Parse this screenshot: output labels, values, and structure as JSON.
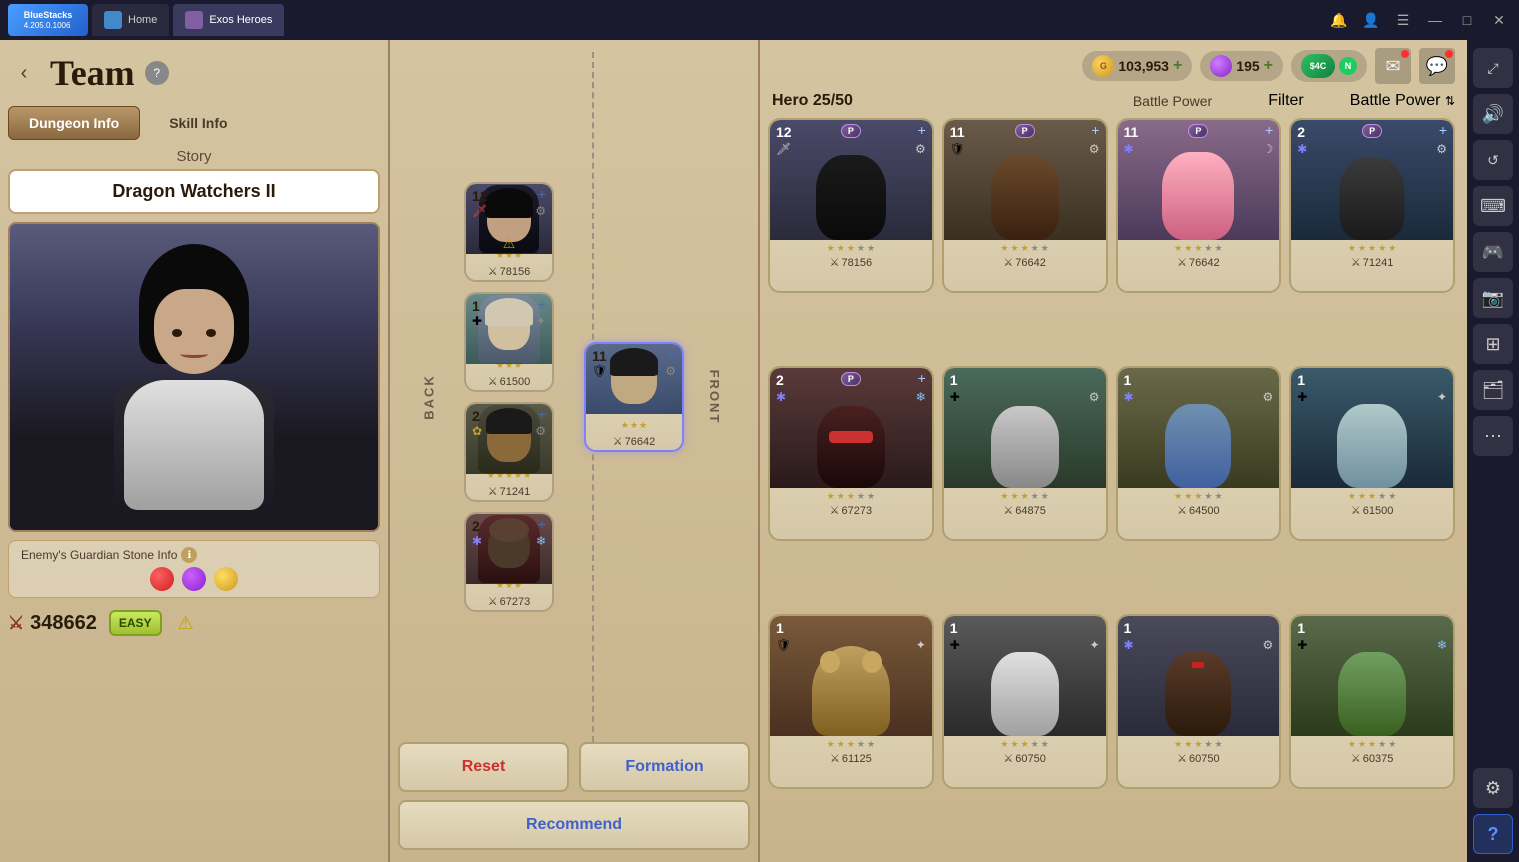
{
  "app": {
    "name": "BlueStacks",
    "version": "4.205.0.1006"
  },
  "taskbar": {
    "tabs": [
      {
        "id": "home",
        "label": "Home",
        "active": false
      },
      {
        "id": "exos",
        "label": "Exos Heroes",
        "active": true
      }
    ],
    "controls": [
      "—",
      "□",
      "✕"
    ]
  },
  "header": {
    "back_label": "‹",
    "title": "Team",
    "help": "?"
  },
  "currency": {
    "gold_amount": "103,953",
    "gem_amount": "195",
    "special_label": "$4C",
    "special_n": "N"
  },
  "tabs": [
    {
      "id": "dungeon",
      "label": "Dungeon Info",
      "active": true
    },
    {
      "id": "skill",
      "label": "Skill Info",
      "active": false
    }
  ],
  "story": {
    "label": "Story",
    "dungeon_name": "Dragon Watchers II"
  },
  "guardian_info": {
    "title": "Enemy's Guardian Stone Info",
    "info_icon": "ℹ"
  },
  "stats": {
    "battle_power": "348662",
    "difficulty": "EASY"
  },
  "formation": {
    "back_label": "BACK",
    "front_label": "FRONT",
    "heroes": [
      {
        "id": 1,
        "level": "12",
        "power": "78156",
        "stars": 3,
        "element": "🗡",
        "gear": "⚙",
        "warning": true,
        "bg": "avatar-1"
      },
      {
        "id": 2,
        "level": "1",
        "power": "61500",
        "stars": 3,
        "element": "✚",
        "gear": "✦",
        "warning": false,
        "bg": "avatar-2"
      },
      {
        "id": 3,
        "level": "2",
        "power": "71241",
        "stars": 5,
        "element": "✿",
        "gear": "⚙",
        "warning": false,
        "bg": "avatar-3"
      },
      {
        "id": 4,
        "level": "2",
        "power": "67273",
        "stars": 3,
        "element": "✱",
        "gear": "❄",
        "warning": false,
        "bg": "avatar-4"
      }
    ],
    "front_hero": {
      "level": "11",
      "power": "76642",
      "stars": 3,
      "bg": "avatar-5"
    },
    "reset_label": "Reset",
    "formation_label": "Formation",
    "recommend_label": "Recommend"
  },
  "hero_list": {
    "header": "Hero",
    "count": "25/50",
    "battle_power_label": "Battle Power",
    "filter_label": "Filter",
    "battle_power_label2": "Battle Power",
    "sort_icon": "⇅",
    "heroes": [
      {
        "id": 1,
        "level": "12",
        "power": "78156",
        "stars": 3,
        "element": "🗡",
        "gear": "⚙",
        "badge": "P",
        "bg": "hero-card-bg-1",
        "face": "face-1"
      },
      {
        "id": 2,
        "level": "11",
        "power": "76642",
        "stars": 3,
        "element": "🛡",
        "gear": "⚙",
        "badge": "P",
        "bg": "hero-card-bg-2",
        "face": "face-2"
      },
      {
        "id": 3,
        "level": "11",
        "power": "76642",
        "stars": 3,
        "element": "✱",
        "gear": "☽",
        "badge": "P",
        "bg": "hero-card-bg-3",
        "face": "face-3"
      },
      {
        "id": 4,
        "level": "2",
        "power": "71241",
        "stars": 5,
        "element": "✱",
        "gear": "⚙",
        "badge": "P",
        "bg": "hero-card-bg-4",
        "face": "face-4"
      },
      {
        "id": 5,
        "level": "2",
        "power": "67273",
        "stars": 3,
        "element": "✱",
        "gear": "❄",
        "badge": "P",
        "bg": "hero-card-bg-5",
        "face": "face-5"
      },
      {
        "id": 6,
        "level": "1",
        "power": "64875",
        "stars": 3,
        "element": "✚",
        "gear": "⚙",
        "badge": "",
        "bg": "hero-card-bg-6",
        "face": "face-6"
      },
      {
        "id": 7,
        "level": "1",
        "power": "64500",
        "stars": 3,
        "element": "✱",
        "gear": "⚙",
        "badge": "",
        "bg": "hero-card-bg-7",
        "face": "face-7"
      },
      {
        "id": 8,
        "level": "1",
        "power": "61500",
        "stars": 3,
        "element": "✚",
        "gear": "✦",
        "badge": "",
        "bg": "hero-card-bg-8",
        "face": "face-8"
      },
      {
        "id": 9,
        "level": "1",
        "power": "61125",
        "stars": 3,
        "element": "🛡",
        "gear": "✦",
        "badge": "",
        "bg": "hero-card-bg-9",
        "face": "face-9"
      },
      {
        "id": 10,
        "level": "1",
        "power": "60750",
        "stars": 3,
        "element": "✚",
        "gear": "✦",
        "badge": "",
        "bg": "hero-card-bg-10",
        "face": "face-10"
      },
      {
        "id": 11,
        "level": "1",
        "power": "60750",
        "stars": 3,
        "element": "✱",
        "gear": "⚙",
        "badge": "",
        "bg": "hero-card-bg-11",
        "face": "face-11"
      },
      {
        "id": 12,
        "level": "1",
        "power": "60375",
        "stars": 3,
        "element": "✚",
        "gear": "❄",
        "badge": "",
        "bg": "hero-card-bg-12",
        "face": "face-12"
      }
    ]
  },
  "right_sidebar": {
    "icons": [
      "🔊",
      "⟳",
      "⬛",
      "☰",
      "📷",
      "⊞",
      "⋯",
      "⚙",
      "?"
    ]
  }
}
